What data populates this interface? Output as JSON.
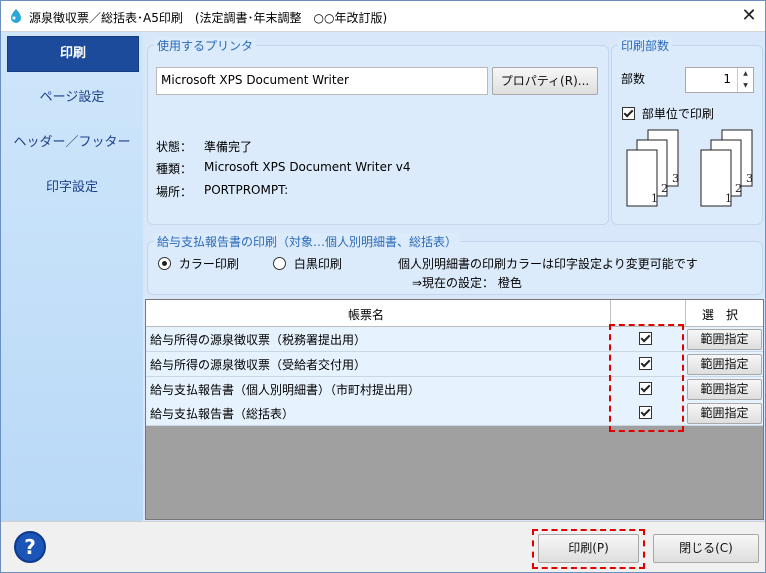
{
  "window": {
    "title": "源泉徴収票／総括表･A5印刷　(法定調書･年末調整　○○年改訂版)",
    "close_glyph": "✕"
  },
  "sidebar": {
    "items": [
      {
        "label": "印刷",
        "active": true
      },
      {
        "label": "ページ設定"
      },
      {
        "label": "ヘッダー／フッター"
      },
      {
        "label": "印字設定"
      }
    ]
  },
  "printer": {
    "group_title": "使用するプリンタ",
    "selected": "Microsoft XPS Document Writer",
    "properties_label": "プロパティ(R)...",
    "status_label": "状態：",
    "status_value": "準備完了",
    "type_label": "種類：",
    "type_value": "Microsoft XPS Document Writer v4",
    "location_label": "場所：",
    "location_value": "PORTPROMPT:"
  },
  "copies": {
    "group_title": "印刷部数",
    "count_label": "部数",
    "count_value": "1",
    "collate_label": "部単位で印刷",
    "collate_checked": true
  },
  "report_print": {
    "group_title": "給与支払報告書の印刷（対象…個人別明細書、総括表）",
    "color_option": "カラー印刷",
    "mono_option": "白黒印刷",
    "selected": "color",
    "note_line1": "個人別明細書の印刷カラーは印字設定より変更可能です",
    "note_line2": "⇒現在の設定： 橙色"
  },
  "table": {
    "header_name": "帳票名",
    "header_select": "選　択",
    "range_label": "範囲指定",
    "rows": [
      {
        "name": "給与所得の源泉徴収票（税務署提出用）",
        "checked": true
      },
      {
        "name": "給与所得の源泉徴収票（受給者交付用）",
        "checked": true
      },
      {
        "name": "給与支払報告書（個人別明細書）（市町村提出用）",
        "checked": true
      },
      {
        "name": "給与支払報告書（総括表）",
        "checked": true
      }
    ]
  },
  "footer": {
    "help_glyph": "?",
    "print_label": "印刷(P)",
    "close_label": "閉じる(C)"
  },
  "colors": {
    "accent": "#1d4b9c",
    "group_title": "#2a6ab8",
    "highlight": "#e00000"
  }
}
